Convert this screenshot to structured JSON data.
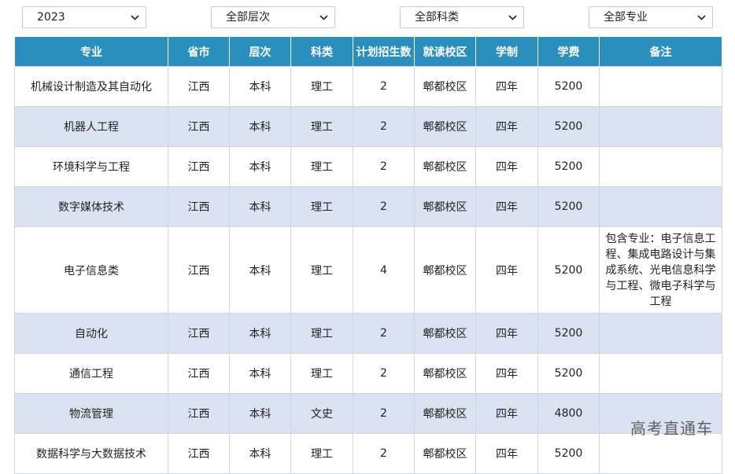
{
  "filters": {
    "year": "2023",
    "level": "全部层次",
    "category": "全部科类",
    "major": "全部专业"
  },
  "table": {
    "headers": [
      "专业",
      "省市",
      "层次",
      "科类",
      "计划招生数",
      "就读校区",
      "学制",
      "学费",
      "备注"
    ],
    "rows": [
      {
        "major": "机械设计制造及其自动化",
        "province": "江西",
        "level": "本科",
        "category": "理工",
        "plan": "2",
        "campus": "郫都校区",
        "duration": "四年",
        "tuition": "5200",
        "note": ""
      },
      {
        "major": "机器人工程",
        "province": "江西",
        "level": "本科",
        "category": "理工",
        "plan": "2",
        "campus": "郫都校区",
        "duration": "四年",
        "tuition": "5200",
        "note": ""
      },
      {
        "major": "环境科学与工程",
        "province": "江西",
        "level": "本科",
        "category": "理工",
        "plan": "2",
        "campus": "郫都校区",
        "duration": "四年",
        "tuition": "5200",
        "note": ""
      },
      {
        "major": "数字媒体技术",
        "province": "江西",
        "level": "本科",
        "category": "理工",
        "plan": "2",
        "campus": "郫都校区",
        "duration": "四年",
        "tuition": "5200",
        "note": ""
      },
      {
        "major": "电子信息类",
        "province": "江西",
        "level": "本科",
        "category": "理工",
        "plan": "4",
        "campus": "郫都校区",
        "duration": "四年",
        "tuition": "5200",
        "note": "包含专业：电子信息工程、集成电路设计与集成系统、光电信息科学与工程、微电子科学与工程"
      },
      {
        "major": "自动化",
        "province": "江西",
        "level": "本科",
        "category": "理工",
        "plan": "2",
        "campus": "郫都校区",
        "duration": "四年",
        "tuition": "5200",
        "note": ""
      },
      {
        "major": "通信工程",
        "province": "江西",
        "level": "本科",
        "category": "理工",
        "plan": "2",
        "campus": "郫都校区",
        "duration": "四年",
        "tuition": "5200",
        "note": ""
      },
      {
        "major": "物流管理",
        "province": "江西",
        "level": "本科",
        "category": "文史",
        "plan": "2",
        "campus": "郫都校区",
        "duration": "四年",
        "tuition": "4800",
        "note": ""
      },
      {
        "major": "数据科学与大数据技术",
        "province": "江西",
        "level": "本科",
        "category": "理工",
        "plan": "2",
        "campus": "郫都校区",
        "duration": "四年",
        "tuition": "5200",
        "note": ""
      }
    ]
  },
  "watermark": "高考直通车",
  "colors": {
    "header_bg": "#2a8fbc",
    "stripe_bg": "#dbe3f2"
  }
}
